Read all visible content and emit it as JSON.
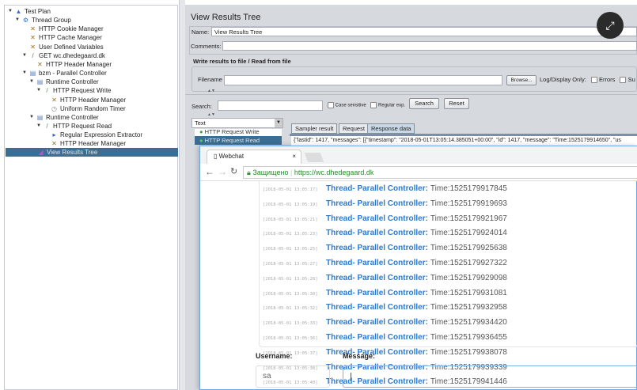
{
  "tree": [
    {
      "label": "Test Plan",
      "icon": "flask-icon",
      "level": 0
    },
    {
      "label": "Thread Group",
      "icon": "gear-icon",
      "level": 1
    },
    {
      "label": "HTTP Cookie Manager",
      "icon": "wrench-icon",
      "level": 2
    },
    {
      "label": "HTTP Cache Manager",
      "icon": "wrench-icon",
      "level": 2
    },
    {
      "label": "User Defined Variables",
      "icon": "wrench-icon",
      "level": 2
    },
    {
      "label": "GET wc.dhedegaard.dk",
      "icon": "pipette-icon",
      "level": 2
    },
    {
      "label": "HTTP Header Manager",
      "icon": "wrench-icon",
      "level": 3
    },
    {
      "label": "bzm - Parallel Controller",
      "icon": "controller-icon",
      "level": 2
    },
    {
      "label": "Runtime Controller",
      "icon": "controller-icon",
      "level": 3
    },
    {
      "label": "HTTP Request Write",
      "icon": "pipette-icon",
      "level": 4
    },
    {
      "label": "HTTP Header Manager",
      "icon": "wrench-icon",
      "level": 5
    },
    {
      "label": "Uniform Random Timer",
      "icon": "timer-icon",
      "level": 5
    },
    {
      "label": "Runtime Controller",
      "icon": "controller-icon",
      "level": 3
    },
    {
      "label": "HTTP Request Read",
      "icon": "pipette-icon",
      "level": 4
    },
    {
      "label": "Regular Expression Extractor",
      "icon": "extractor-icon",
      "level": 5
    },
    {
      "label": "HTTP Header Manager",
      "icon": "wrench-icon",
      "level": 5
    },
    {
      "label": "View Results Tree",
      "icon": "chart-icon",
      "level": 3
    }
  ],
  "panel": {
    "title": "View Results Tree",
    "name_label": "Name:",
    "name_value": "View Results Tree",
    "comments_label": "Comments:",
    "write_title": "Write results to file / Read from file",
    "filename_label": "Filename",
    "browse": "Browse...",
    "log_only": "Log/Display Only:",
    "errors": "Errors",
    "successes": "Su",
    "search_label": "Search:",
    "case_sensitive": "Case sensitive",
    "regex": "Regular exp.",
    "search_btn": "Search",
    "reset_btn": "Reset",
    "renderer": "Text",
    "results": [
      "HTTP Request Write",
      "HTTP Request Read"
    ],
    "tabs": [
      "Sampler result",
      "Request",
      "Response data"
    ],
    "response": "{\"lastid\": 1417, \"messages\": [{\"timestamp\": \"2018-05-01T13:05:14.385051+00:00\", \"id\": 1417, \"message\": \"Time:1525179914650\", \"us"
  },
  "browser": {
    "tab_title": "Webchat",
    "secure": "Защищено",
    "url": "https://wc.dhedegaard.dk",
    "messages": [
      {
        "ts": "[2018-05-01 13:05:17]",
        "user": "Thread- Parallel Controller:",
        "text": "Time:1525179917845"
      },
      {
        "ts": "[2018-05-01 13:05:19]",
        "user": "Thread- Parallel Controller:",
        "text": "Time:1525179919693"
      },
      {
        "ts": "[2018-05-01 13:05:21]",
        "user": "Thread- Parallel Controller:",
        "text": "Time:1525179921967"
      },
      {
        "ts": "[2018-05-01 13:05:23]",
        "user": "Thread- Parallel Controller:",
        "text": "Time:1525179924014"
      },
      {
        "ts": "[2018-05-01 13:05:25]",
        "user": "Thread- Parallel Controller:",
        "text": "Time:1525179925638"
      },
      {
        "ts": "[2018-05-01 13:05:27]",
        "user": "Thread- Parallel Controller:",
        "text": "Time:1525179927322"
      },
      {
        "ts": "[2018-05-01 13:05:28]",
        "user": "Thread- Parallel Controller:",
        "text": "Time:1525179929098"
      },
      {
        "ts": "[2018-05-01 13:05:30]",
        "user": "Thread- Parallel Controller:",
        "text": "Time:1525179931081"
      },
      {
        "ts": "[2018-05-01 13:05:32]",
        "user": "Thread- Parallel Controller:",
        "text": "Time:1525179932958"
      },
      {
        "ts": "[2018-05-01 13:05:33]",
        "user": "Thread- Parallel Controller:",
        "text": "Time:1525179934420"
      },
      {
        "ts": "[2018-05-01 13:05:36]",
        "user": "Thread- Parallel Controller:",
        "text": "Time:1525179936455"
      },
      {
        "ts": "[2018-05-01 13:05:37]",
        "user": "Thread- Parallel Controller:",
        "text": "Time:1525179938078"
      },
      {
        "ts": "[2018-05-01 13:05:38]",
        "user": "Thread- Parallel Controller:",
        "text": "Time:1525179939339"
      },
      {
        "ts": "[2018-05-01 13:05:40]",
        "user": "Thread- Parallel Controller:",
        "text": "Time:1525179941446"
      }
    ],
    "username_label": "Username:",
    "username_value": "sa",
    "message_label": "Message:"
  }
}
